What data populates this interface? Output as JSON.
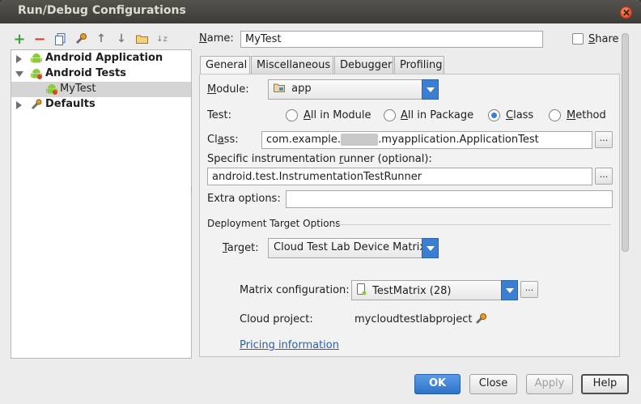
{
  "window": {
    "title": "Run/Debug Configurations"
  },
  "toolbar": {
    "add": "+",
    "remove": "−",
    "copy": "⎘",
    "edit_defaults": "🔧",
    "move_up": "↑",
    "move_down": "↓",
    "folder": "▭",
    "sort": "↓z"
  },
  "tree": {
    "items": [
      {
        "label": "Android Application"
      },
      {
        "label": "Android Tests"
      },
      {
        "label": "MyTest"
      },
      {
        "label": "Defaults"
      }
    ]
  },
  "header": {
    "name_label_u": "N",
    "name_label_rest": "ame:",
    "name_value": "MyTest",
    "share_label_u": "S",
    "share_label_rest": "hare"
  },
  "tabs": [
    "General",
    "Miscellaneous",
    "Debugger",
    "Profiling"
  ],
  "general": {
    "module_label_u": "M",
    "module_label_rest": "odule:",
    "module_value": "app",
    "test_label": "Test:",
    "radios": [
      {
        "u": "A",
        "rest": "ll in Module"
      },
      {
        "u": "A",
        "rest": "ll in Package"
      },
      {
        "u": "C",
        "rest": "lass"
      },
      {
        "u": "M",
        "rest": "ethod"
      }
    ],
    "class_label_pre": "Cl",
    "class_label_u": "a",
    "class_label_post": "ss:",
    "class_value_pre": "com.example.",
    "class_value_hidden": "xxxxxx",
    "class_value_post": ".myapplication.ApplicationTest",
    "runner_label_pre": "Specific instrumentation ",
    "runner_label_u": "r",
    "runner_label_post": "unner (optional):",
    "runner_value": "android.test.InstrumentationTestRunner",
    "extra_label": "Extra options:",
    "extra_value": "",
    "deployment_header": "Deployment Target Options",
    "target_label_u": "T",
    "target_label_rest": "arget:",
    "target_value": "Cloud Test Lab Device Matrix",
    "matrix_label": "Matrix configuration:",
    "matrix_value": "TestMatrix (28)",
    "cloud_project_label": "Cloud project:",
    "cloud_project_value": "mycloudtestlabproject",
    "pricing_link": "Pricing information",
    "dots": "..."
  },
  "buttons": {
    "ok": "OK",
    "close": "Close",
    "apply": "Apply",
    "help": "Help"
  },
  "colors": {
    "accent": "#3b7fd2",
    "android_green": "#8cc93f",
    "link": "#2a5db0"
  }
}
